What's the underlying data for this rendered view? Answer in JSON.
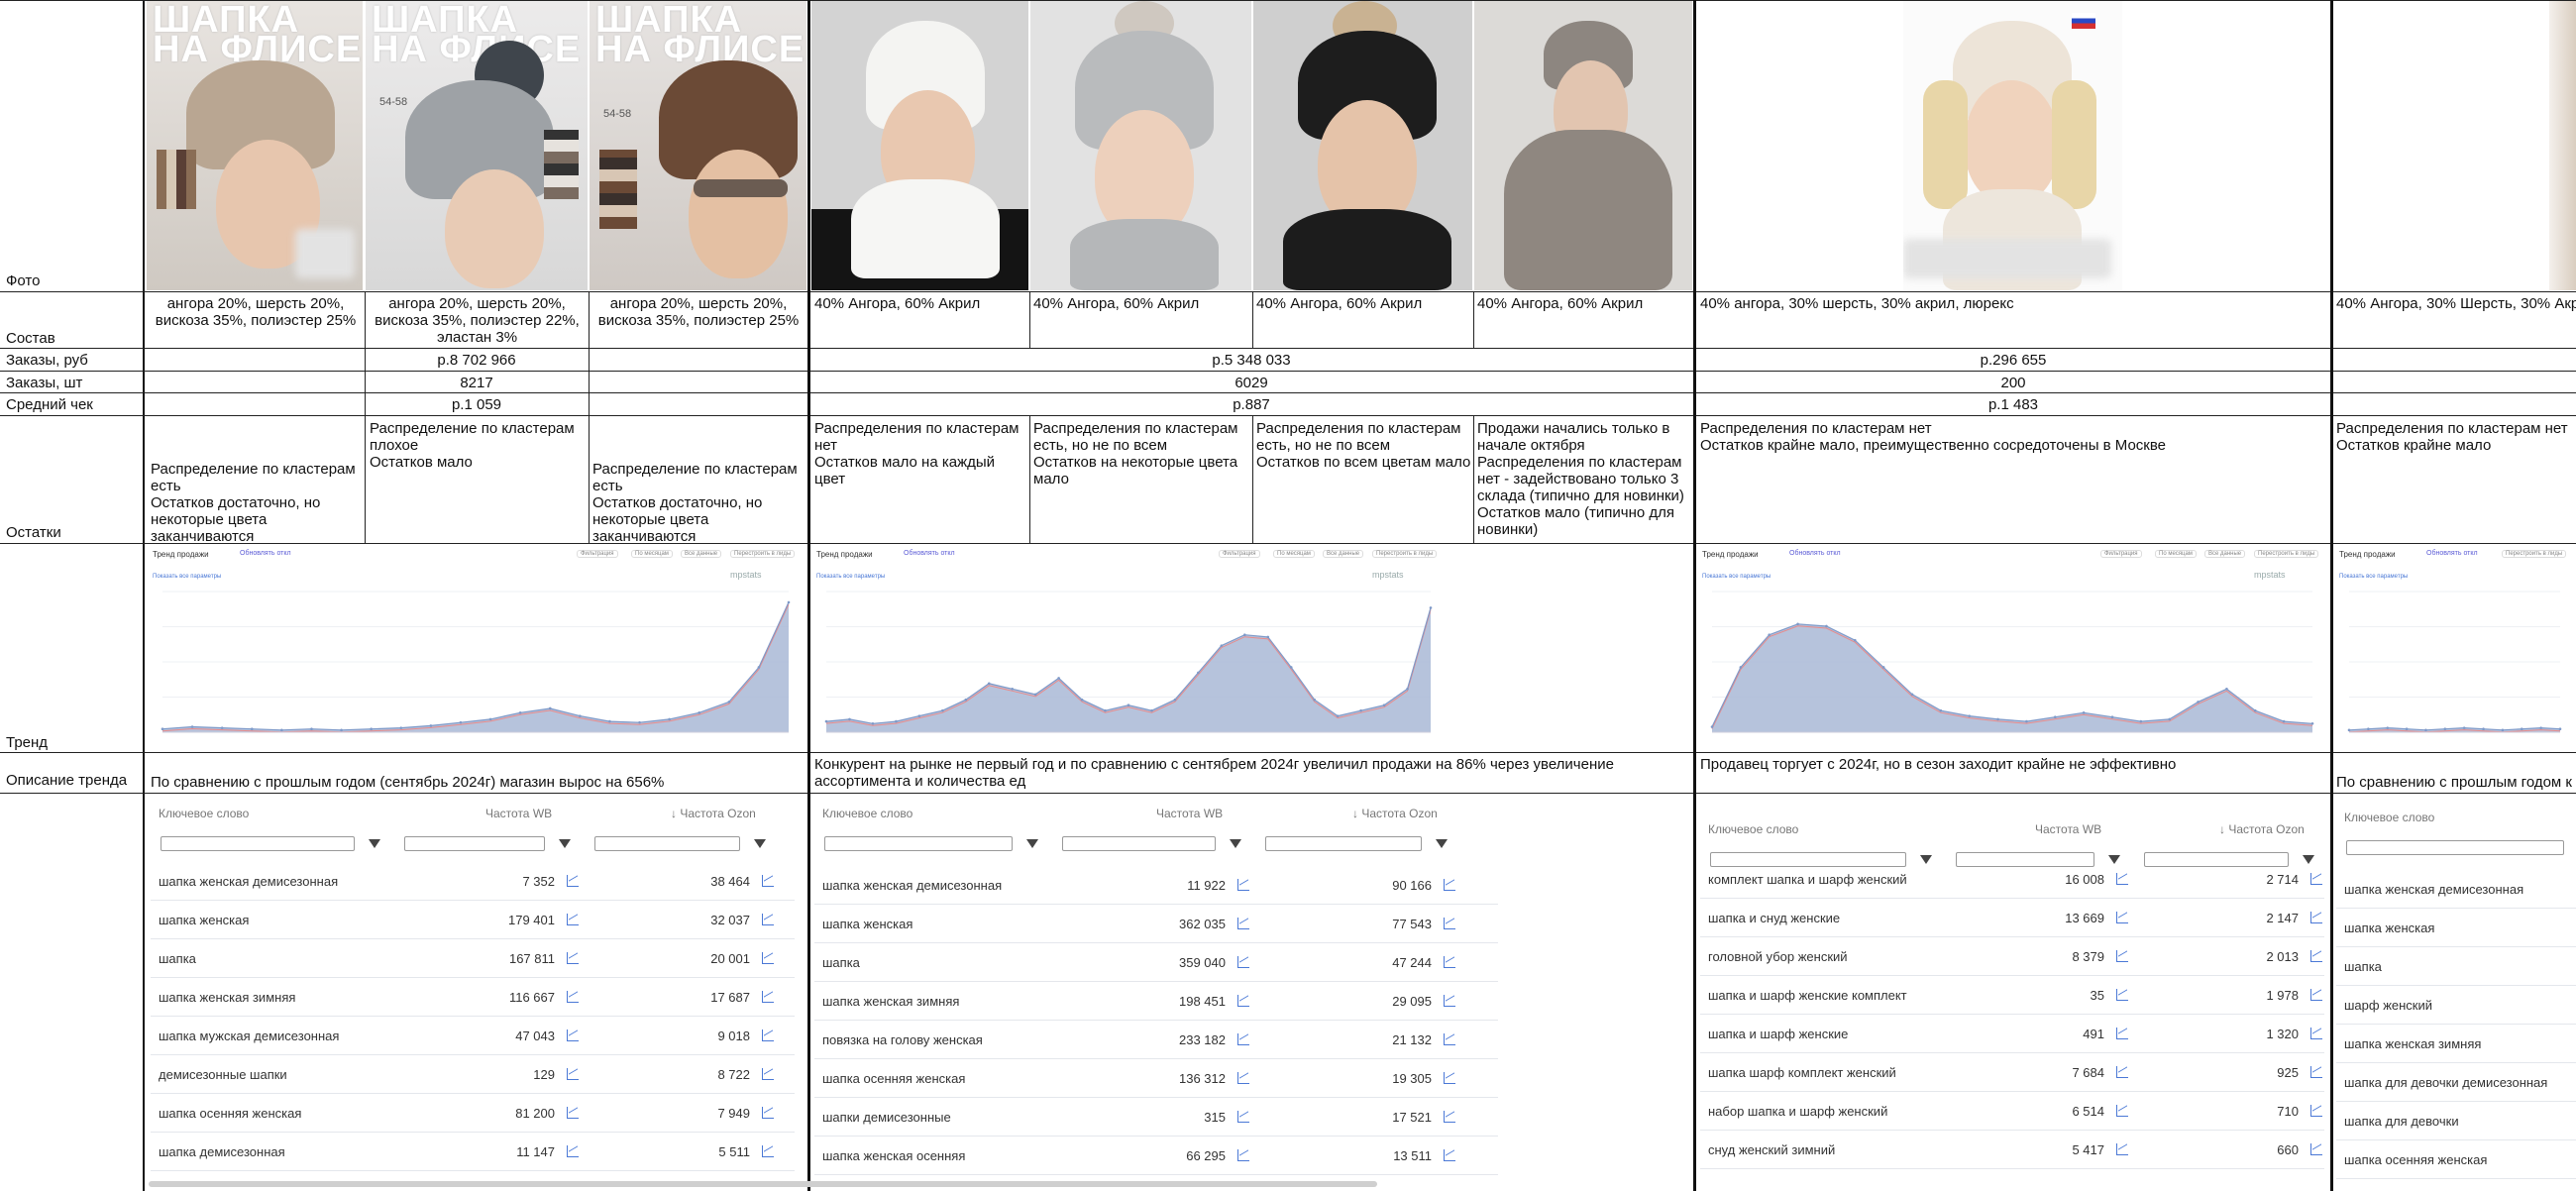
{
  "row_labels": {
    "photo": "Фото",
    "composition": "Состав",
    "orders_rub": "Заказы, руб",
    "orders_qty": "Заказы, шт",
    "avg_check": "Средний чек",
    "stock": "Остатки",
    "trend": "Тренд",
    "trend_description": "Описание тренда"
  },
  "photo_overlays": {
    "title_line1": "ШАПКА",
    "title_line2": "НА ФЛИСЕ",
    "size_label": "54-58"
  },
  "group1": {
    "compositions": [
      "ангора 20%, шерсть 20%, вискоза 35%, полиэстер 25%",
      "ангора 20%, шерсть 20%, вискоза 35%, полиэстер 22%, эластан 3%",
      "ангора 20%, шерсть 20%, вискоза 35%, полиэстер 25%"
    ],
    "orders_rub": "р.8 702 966",
    "orders_qty": "8217",
    "avg_check": "р.1 059",
    "stock": [
      [
        "Распределение по кластерам есть",
        "Остатков достаточно, но некоторые цвета заканчиваются"
      ],
      [
        "Распределение по кластерам плохое",
        "Остатков мало"
      ],
      [
        "Распределение по кластерам есть",
        "Остатков достаточно, но некоторые цвета заканчиваются"
      ]
    ],
    "trend_description": "По сравнению с прошлым годом (сентябрь 2024г) магазин вырос на 656%"
  },
  "group2": {
    "compositions": [
      "40% Ангора, 60% Акрил",
      "40% Ангора, 60% Акрил",
      "40% Ангора, 60% Акрил",
      "40% Ангора, 60% Акрил"
    ],
    "orders_rub": "р.5 348 033",
    "orders_qty": "6029",
    "avg_check": "р.887",
    "stock": [
      [
        "Распределения по кластерам нет",
        "Остатков мало на каждый цвет"
      ],
      [
        "Распределения по кластерам есть, но не по всем",
        "Остатков на некоторые цвета мало"
      ],
      [
        "Распределения по кластерам есть, но не по всем",
        "Остатков по всем цветам мало"
      ],
      [
        "Продажи начались только в начале октября",
        "Распределения по кластерам нет - задействовано только 3 склада (типично для новинки)",
        "Остатков мало (типично для новинки)"
      ]
    ],
    "trend_description": "Конкурент на рынке не первый год и по сравнению с сентябрем 2024г увеличил продажи на 86% через увеличение ассортимента и количества ед"
  },
  "group3": {
    "compositions": [
      "40% ангора, 30% шерсть, 30% акрил, люрекс"
    ],
    "orders_rub": "р.296 655",
    "orders_qty": "200",
    "avg_check": "р.1 483",
    "stock": [
      [
        "Распределения по кластерам нет",
        "Остатков крайне мало, преимущественно сосредоточены в Москве"
      ]
    ],
    "trend_description": "Продавец торгует с 2024г, но в сезон заходит крайне не эффективно"
  },
  "group4": {
    "compositions": [
      "40% Ангора, 30% Шерсть, 30% Акр"
    ],
    "stock": [
      [
        "Распределения по кластерам нет",
        "Остатков крайне мало"
      ]
    ],
    "trend_description": "По сравнению с прошлым годом к"
  },
  "trend_chart": {
    "title": "Тренд продажи",
    "toggle": "Обновлять откл",
    "buttons": [
      "Фильтрация",
      "По месяцам",
      "Все данные",
      "Перестроить в лиды"
    ],
    "watermark": "mpstats",
    "link": "Показать все параметры"
  },
  "chart_data": [
    {
      "type": "area",
      "title": "Тренд продажи",
      "series": [
        {
          "values": [
            3,
            5,
            4,
            3,
            2,
            3,
            2,
            3,
            4,
            6,
            9,
            12,
            18,
            22,
            15,
            10,
            9,
            12,
            18,
            28,
            60,
            120
          ]
        }
      ],
      "ylim": [
        0,
        130
      ]
    },
    {
      "type": "area",
      "title": "Тренд продажи",
      "series": [
        {
          "values": [
            10,
            12,
            8,
            10,
            15,
            20,
            30,
            45,
            40,
            35,
            50,
            30,
            20,
            25,
            20,
            30,
            55,
            80,
            90,
            88,
            60,
            30,
            15,
            20,
            25,
            40,
            115
          ]
        }
      ],
      "ylim": [
        0,
        130
      ]
    },
    {
      "type": "area",
      "title": "Тренд продажи",
      "series": [
        {
          "values": [
            5,
            60,
            90,
            100,
            98,
            85,
            60,
            35,
            20,
            15,
            12,
            10,
            14,
            18,
            14,
            10,
            12,
            28,
            40,
            20,
            10,
            8
          ]
        }
      ],
      "ylim": [
        0,
        130
      ]
    },
    {
      "type": "area",
      "title": "Тренд продажи",
      "series": [
        {
          "values": [
            2,
            3,
            4,
            3,
            2,
            3,
            4,
            3,
            2,
            3,
            4,
            3
          ]
        }
      ],
      "ylim": [
        0,
        130
      ]
    }
  ],
  "keyword_tables": {
    "headers": {
      "keyword": "Ключевое слово",
      "wb": "Частота WB",
      "ozon": "↓ Частота Ozon"
    },
    "t1": [
      {
        "kw": "шапка женская демисезонная",
        "wb": "7 352",
        "oz": "38 464"
      },
      {
        "kw": "шапка женская",
        "wb": "179 401",
        "oz": "32 037"
      },
      {
        "kw": "шапка",
        "wb": "167 811",
        "oz": "20 001"
      },
      {
        "kw": "шапка женская зимняя",
        "wb": "116 667",
        "oz": "17 687"
      },
      {
        "kw": "шапка мужская демисезонная",
        "wb": "47 043",
        "oz": "9 018"
      },
      {
        "kw": "демисезонные шапки",
        "wb": "129",
        "oz": "8 722"
      },
      {
        "kw": "шапка осенняя женская",
        "wb": "81 200",
        "oz": "7 949"
      },
      {
        "kw": "шапка демисезонная",
        "wb": "11 147",
        "oz": "5 511"
      }
    ],
    "t2": [
      {
        "kw": "шапка женская демисезонная",
        "wb": "11 922",
        "oz": "90 166"
      },
      {
        "kw": "шапка женская",
        "wb": "362 035",
        "oz": "77 543"
      },
      {
        "kw": "шапка",
        "wb": "359 040",
        "oz": "47 244"
      },
      {
        "kw": "шапка женская зимняя",
        "wb": "198 451",
        "oz": "29 095"
      },
      {
        "kw": "повязка на голову женская",
        "wb": "233 182",
        "oz": "21 132"
      },
      {
        "kw": "шапка осенняя женская",
        "wb": "136 312",
        "oz": "19 305"
      },
      {
        "kw": "шапки демисезонные",
        "wb": "315",
        "oz": "17 521"
      },
      {
        "kw": "шапка женская осенняя",
        "wb": "66 295",
        "oz": "13 511"
      }
    ],
    "t3": [
      {
        "kw": "комплект шапка и шарф женский",
        "wb": "16 008",
        "oz": "2 714"
      },
      {
        "kw": "шапка и снуд женские",
        "wb": "13 669",
        "oz": "2 147"
      },
      {
        "kw": "головной убор женский",
        "wb": "8 379",
        "oz": "2 013"
      },
      {
        "kw": "шапка и шарф женские комплект",
        "wb": "35",
        "oz": "1 978"
      },
      {
        "kw": "шапка и шарф женские",
        "wb": "491",
        "oz": "1 320"
      },
      {
        "kw": "шапка шарф комплект женский",
        "wb": "7 684",
        "oz": "925"
      },
      {
        "kw": "набор шапка и шарф женский",
        "wb": "6 514",
        "oz": "710"
      },
      {
        "kw": "снуд женский зимний",
        "wb": "5 417",
        "oz": "660"
      }
    ],
    "t4": [
      {
        "kw": "шапка женская демисезонная"
      },
      {
        "kw": "шапка женская"
      },
      {
        "kw": "шапка"
      },
      {
        "kw": "шарф женский"
      },
      {
        "kw": "шапка женская зимняя"
      },
      {
        "kw": "шапка для девочки демисезонная"
      },
      {
        "kw": "шапка для девочки"
      },
      {
        "kw": "шапка осенняя женская"
      }
    ]
  },
  "colors": {
    "chart_fill": "#a9b9d6",
    "chart_line": "#7e99c8",
    "chart_red": "#e88a8a",
    "link": "#4a78d6"
  }
}
